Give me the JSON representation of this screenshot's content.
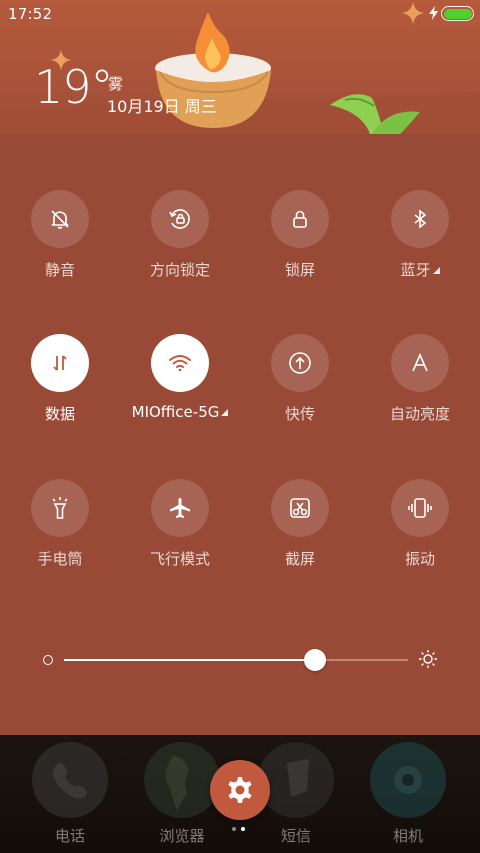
{
  "status_bar": {
    "time": "17:52",
    "battery_color": "#4fd02a"
  },
  "weather": {
    "temperature": "19°",
    "condition": "雾",
    "date": "10月19日 周三"
  },
  "toggles": [
    {
      "id": "mute",
      "label": "静音",
      "icon": "bell-off-icon",
      "active": false
    },
    {
      "id": "rotation-lock",
      "label": "方向锁定",
      "icon": "rotation-lock-icon",
      "active": false
    },
    {
      "id": "lock-screen",
      "label": "锁屏",
      "icon": "lock-icon",
      "active": false
    },
    {
      "id": "bluetooth",
      "label": "蓝牙",
      "icon": "bluetooth-icon",
      "active": false,
      "has_more": true
    },
    {
      "id": "data",
      "label": "数据",
      "icon": "data-arrows-icon",
      "active": true
    },
    {
      "id": "wifi",
      "label": "MIOffice-5G",
      "icon": "wifi-icon",
      "active": true,
      "has_more": true
    },
    {
      "id": "quick-send",
      "label": "快传",
      "icon": "upload-icon",
      "active": false
    },
    {
      "id": "auto-brightness",
      "label": "自动亮度",
      "icon": "letter-a-icon",
      "active": false
    },
    {
      "id": "flashlight",
      "label": "手电筒",
      "icon": "flashlight-icon",
      "active": false
    },
    {
      "id": "airplane",
      "label": "飞行模式",
      "icon": "airplane-icon",
      "active": false
    },
    {
      "id": "screenshot",
      "label": "截屏",
      "icon": "scissors-icon",
      "active": false
    },
    {
      "id": "vibrate",
      "label": "振动",
      "icon": "vibrate-icon",
      "active": false
    }
  ],
  "brightness": {
    "level": 0.73
  },
  "dock": {
    "apps": [
      {
        "label": "电话",
        "icon": "phone-app-icon"
      },
      {
        "label": "浏览器",
        "icon": "browser-app-icon"
      },
      {
        "label": "短信",
        "icon": "messages-app-icon"
      },
      {
        "label": "相机",
        "icon": "camera-app-icon"
      }
    ],
    "settings_icon": "gear-icon",
    "page_indicator": {
      "pages": 2,
      "current": 1
    }
  },
  "colors": {
    "panel_bg": "#994a37",
    "header_bg": "#b55a3b",
    "settings_button": "#c0593e"
  }
}
